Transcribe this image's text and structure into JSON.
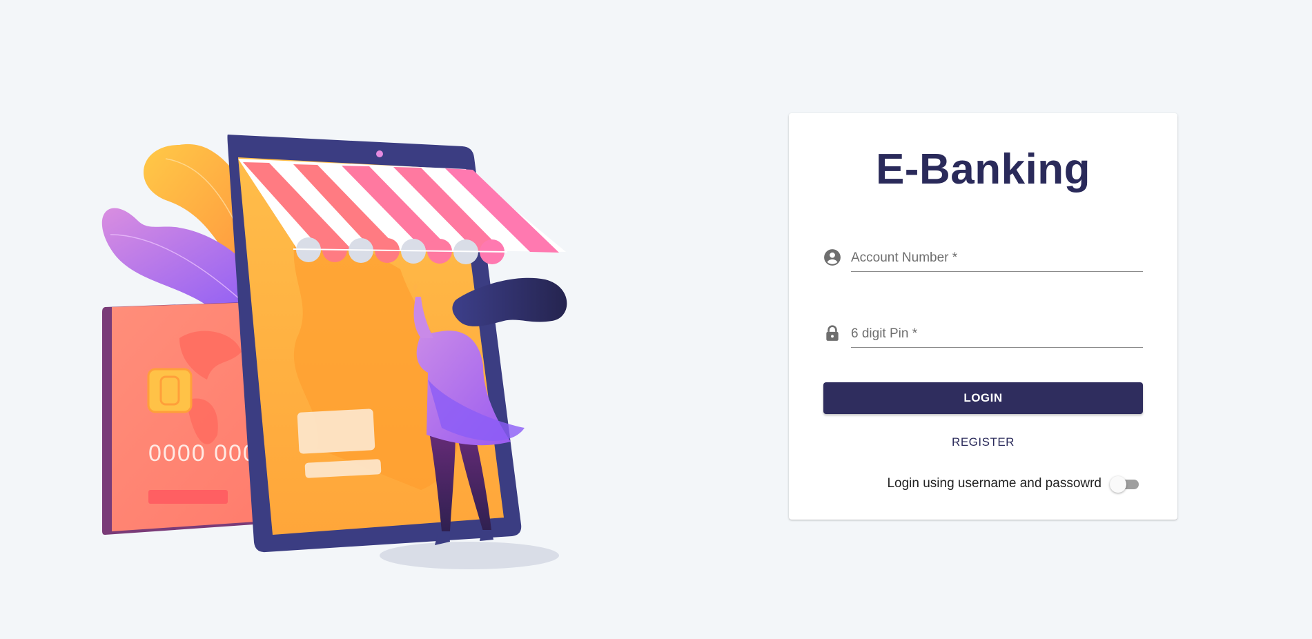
{
  "app": {
    "title": "E-Banking"
  },
  "form": {
    "account_placeholder": "Account Number *",
    "account_value": "",
    "pin_placeholder": "6 digit Pin *",
    "pin_value": "",
    "login_label": "LOGIN",
    "register_label": "REGISTER",
    "toggle_label": "Login using username and passowrd",
    "toggle_on": false
  },
  "illustration": {
    "card_number": "0000 0000 0"
  },
  "icons": {
    "account": "account-circle-icon",
    "pin": "lock-icon"
  },
  "colors": {
    "primary": "#2f2d5e",
    "title": "#2a2a5a",
    "background": "#f3f6f9"
  }
}
